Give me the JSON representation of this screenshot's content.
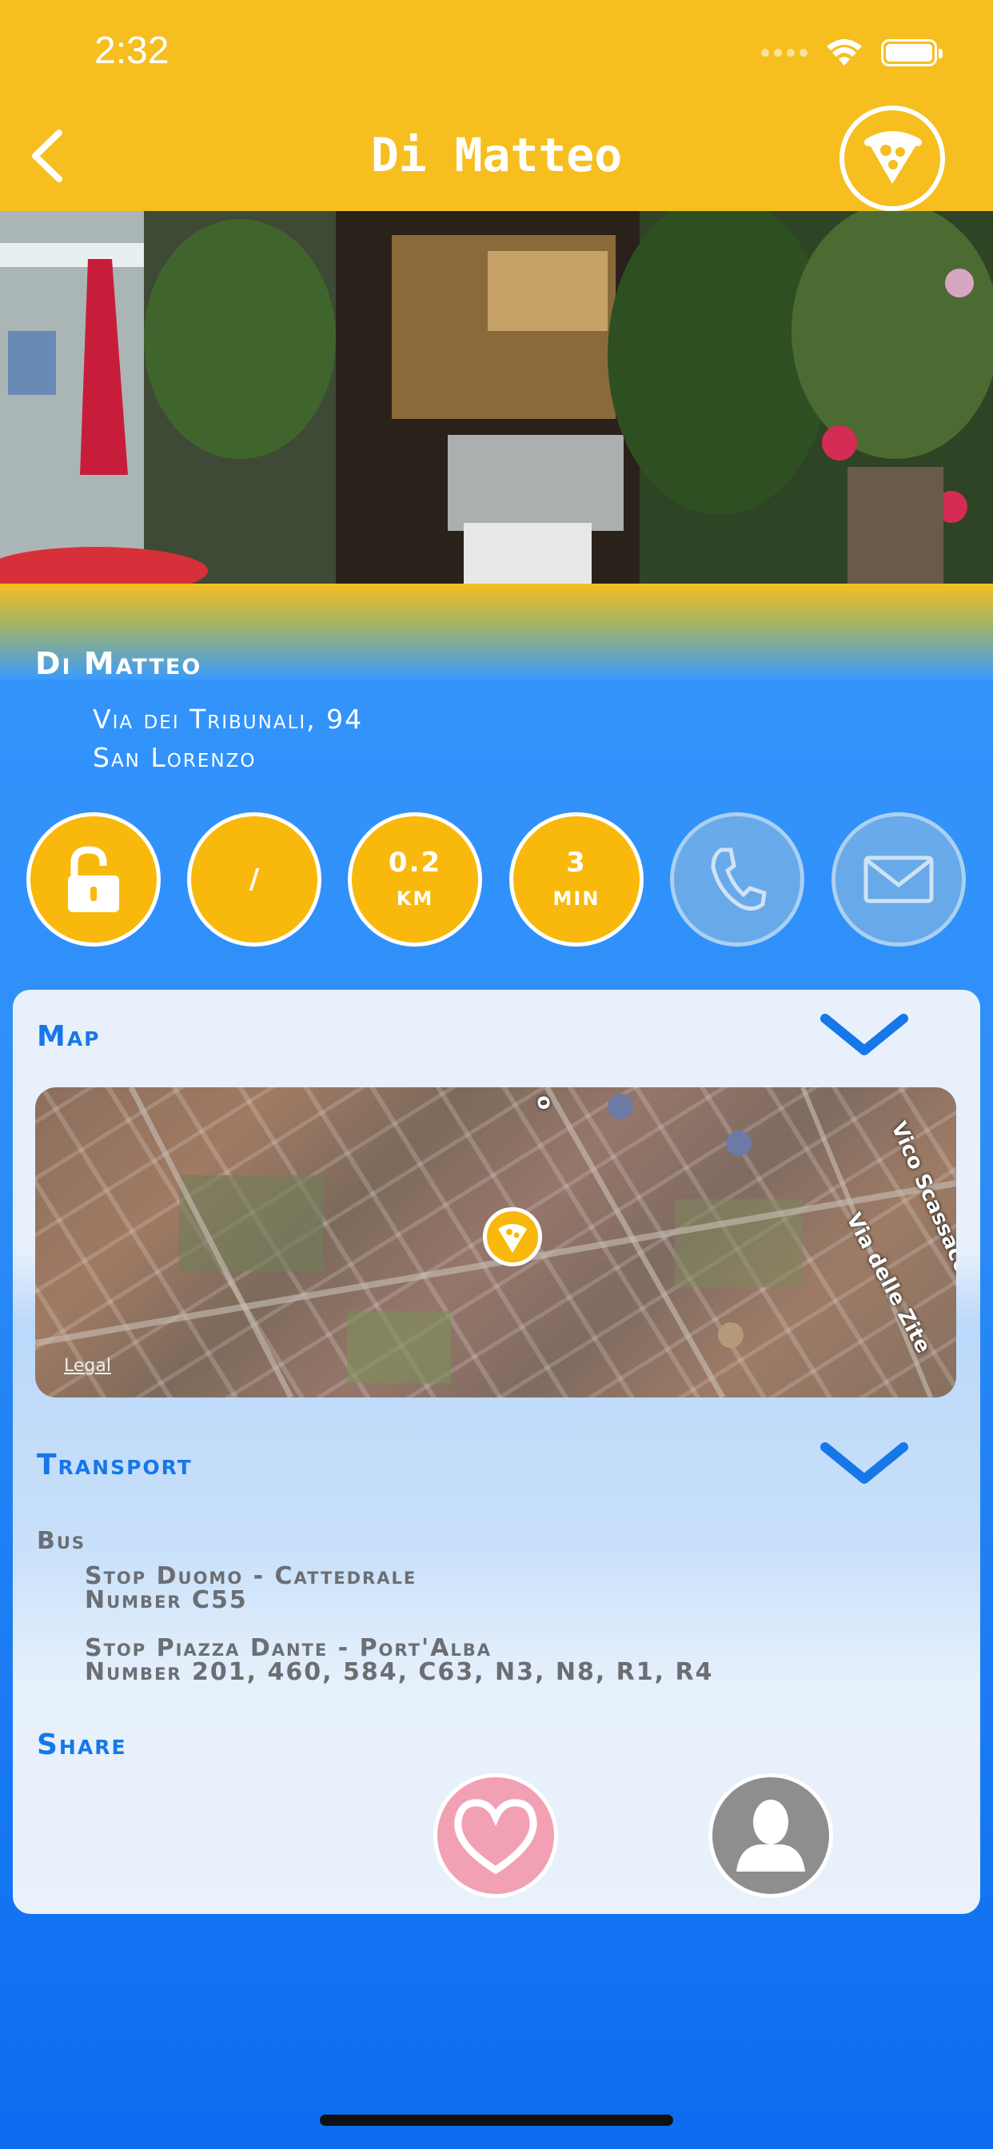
{
  "status": {
    "time": "2:32"
  },
  "nav": {
    "title": "Di Matteo"
  },
  "place": {
    "name": "Di Matteo",
    "address_line1": "Via dei Tribunali, 94",
    "address_line2": "San Lorenzo"
  },
  "info_circles": {
    "status_icon": "unlock-icon",
    "rating": "/",
    "distance_value": "0.2",
    "distance_unit": "km",
    "time_value": "3",
    "time_unit": "min",
    "phone_icon": "phone-icon",
    "mail_icon": "mail-icon"
  },
  "sections": {
    "map_title": "Map",
    "transport_title": "Transport",
    "share_title": "Share"
  },
  "map": {
    "streets": [
      "Vico Scassacocchi",
      "Via delle Zite",
      "o"
    ],
    "legal": "Legal"
  },
  "transport": {
    "mode": "Bus",
    "stops": [
      {
        "stop": "Stop Duomo - Cattedrale",
        "number": "Number C55"
      },
      {
        "stop": "Stop Piazza Dante - Port'Alba",
        "number": "Number 201, 460, 584, C63, N3, N8, R1, R4"
      }
    ]
  },
  "colors": {
    "accent_yellow": "#f6be1f",
    "circle_yellow": "#f8b90c",
    "blue": "#3a9bff",
    "section_blue": "#1677e8"
  }
}
